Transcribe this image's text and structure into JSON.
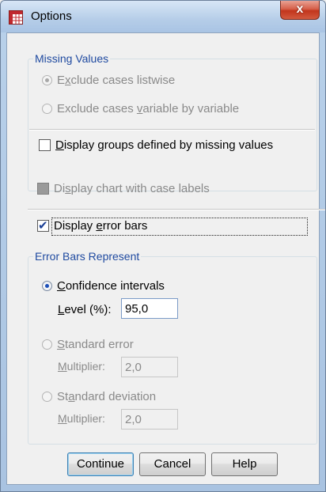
{
  "window": {
    "title": "Options",
    "close_glyph": "x"
  },
  "missing_values": {
    "legend": "Missing Values",
    "listwise": {
      "pre": "E",
      "mn": "x",
      "post": "clude cases listwise"
    },
    "variable": {
      "pre": "Exclude cases ",
      "mn": "v",
      "post": "ariable by variable"
    },
    "display_groups": {
      "pre": "",
      "mn": "D",
      "post": "isplay groups defined by missing values"
    }
  },
  "display_chart_case_labels": {
    "pre": "Di",
    "mn": "s",
    "post": "play chart with case labels"
  },
  "display_error_bars": {
    "pre": "Display ",
    "mn": "e",
    "post": "rror bars"
  },
  "error_bars": {
    "legend": "Error Bars Represent",
    "confidence": {
      "pre": "",
      "mn": "C",
      "post": "onfidence intervals"
    },
    "level": {
      "pre": "",
      "mn": "L",
      "post": "evel (%):",
      "value": "95,0"
    },
    "standard_error": {
      "pre": "",
      "mn": "S",
      "post": "tandard error"
    },
    "se_multiplier": {
      "pre": "",
      "mn": "M",
      "post": "ultiplier:",
      "value": "2,0"
    },
    "standard_deviation": {
      "pre": "St",
      "mn": "a",
      "post": "ndard deviation"
    },
    "sd_multiplier": {
      "pre": "",
      "mn": "M",
      "post": "ultiplier:",
      "value": "2,0"
    }
  },
  "buttons": {
    "continue": "Continue",
    "cancel": "Cancel",
    "help": "Help"
  },
  "colors": {
    "legend": "#1f4aa0",
    "close_button": "#c2351c",
    "disabled_text": "#8a8a8a"
  },
  "icons": {
    "app": "spss-grid-icon",
    "close": "close-icon"
  }
}
